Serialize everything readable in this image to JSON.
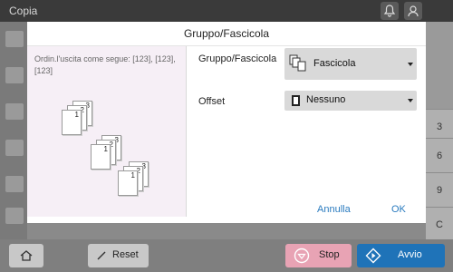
{
  "top": {
    "title": "Copia"
  },
  "dialog": {
    "title": "Gruppo/Fascicola",
    "description": "Ordin.l'uscita come segue: [123], [123], [123]",
    "sheet_labels": [
      "1",
      "2",
      "3"
    ],
    "fields": {
      "gruppo_label": "Gruppo/Fascicola",
      "gruppo_value": "Fascicola",
      "offset_label": "Offset",
      "offset_value": "Nessuno"
    },
    "footer": {
      "cancel": "Annulla",
      "ok": "OK"
    }
  },
  "background_keypad": [
    "3",
    "6",
    "9",
    "C"
  ],
  "bottom": {
    "reset": "Reset",
    "stop": "Stop",
    "start": "Avvio"
  },
  "colors": {
    "accent": "#1f73b8",
    "stop": "#e8a3b4",
    "link": "#2a7bbf"
  },
  "icons": [
    "bell-icon",
    "user-icon",
    "home-icon",
    "reset-icon",
    "stop-icon",
    "start-icon",
    "collate-icon",
    "page-icon"
  ]
}
